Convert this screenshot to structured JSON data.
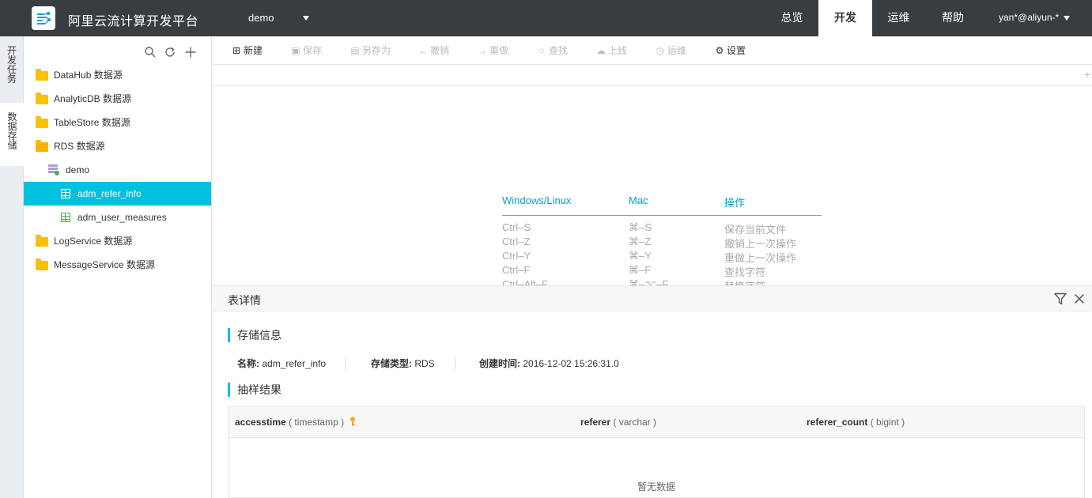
{
  "app": {
    "title": "阿里云流计算开发平台",
    "project": "demo",
    "nav": [
      "总览",
      "开发",
      "运维",
      "帮助"
    ],
    "active_nav": "开发",
    "user": "yan*@aliyun-*"
  },
  "side_tabs": [
    {
      "label": "开发任务",
      "active": false
    },
    {
      "label": "数据存储",
      "active": true
    }
  ],
  "sidebar": {
    "tools": [
      "search-icon",
      "refresh-icon",
      "add-icon"
    ],
    "tree": [
      {
        "label": "DataHub 数据源",
        "type": "folder",
        "level": 0
      },
      {
        "label": "AnalyticDB 数据源",
        "type": "folder",
        "level": 0
      },
      {
        "label": "TableStore 数据源",
        "type": "folder",
        "level": 0
      },
      {
        "label": "RDS 数据源",
        "type": "folder-open",
        "level": 0
      },
      {
        "label": "demo",
        "type": "database",
        "level": 1
      },
      {
        "label": "adm_refer_info",
        "type": "table",
        "level": 2,
        "selected": true
      },
      {
        "label": "adm_user_measures",
        "type": "table",
        "level": 2
      },
      {
        "label": "LogService 数据源",
        "type": "folder",
        "level": 0
      },
      {
        "label": "MessageService 数据源",
        "type": "folder",
        "level": 0
      }
    ]
  },
  "toolbar": {
    "new": "新建",
    "save": "保存",
    "save_as": "另存为",
    "undo": "撤销",
    "redo": "重做",
    "find": "查找",
    "publish": "上线",
    "ops": "运维",
    "settings": "设置"
  },
  "shortcuts": {
    "headers": [
      "Windows/Linux",
      "Mac",
      "操作"
    ],
    "rows": [
      [
        "Ctrl–S",
        "⌘–S",
        "保存当前文件"
      ],
      [
        "Ctrl–Z",
        "⌘–Z",
        "撤销上一次操作"
      ],
      [
        "Ctrl–Y",
        "⌘–Y",
        "重做上一次操作"
      ],
      [
        "Ctrl–F",
        "⌘–F",
        "查找字符"
      ],
      [
        "Ctrl–Alt–F",
        "⌘–⌥–F",
        "替换字符"
      ]
    ]
  },
  "detail_panel": {
    "title": "表详情",
    "storage_section": "存储信息",
    "name_label": "名称:",
    "name_value": "adm_refer_info",
    "type_label": "存储类型:",
    "type_value": "RDS",
    "created_label": "创建时间:",
    "created_value": "2016-12-02 15:26:31.0",
    "sample_section": "抽样结果",
    "columns": [
      {
        "name": "accesstime",
        "type": "( timestamp )",
        "primary_key": true
      },
      {
        "name": "referer",
        "type": "( varchar )"
      },
      {
        "name": "referer_count",
        "type": "( bigint )"
      }
    ],
    "empty_text": "暂无数据"
  },
  "colors": {
    "topbar": "#373d41",
    "accent": "#00c1de",
    "folder": "#f7c100",
    "link": "#00a2ca"
  }
}
